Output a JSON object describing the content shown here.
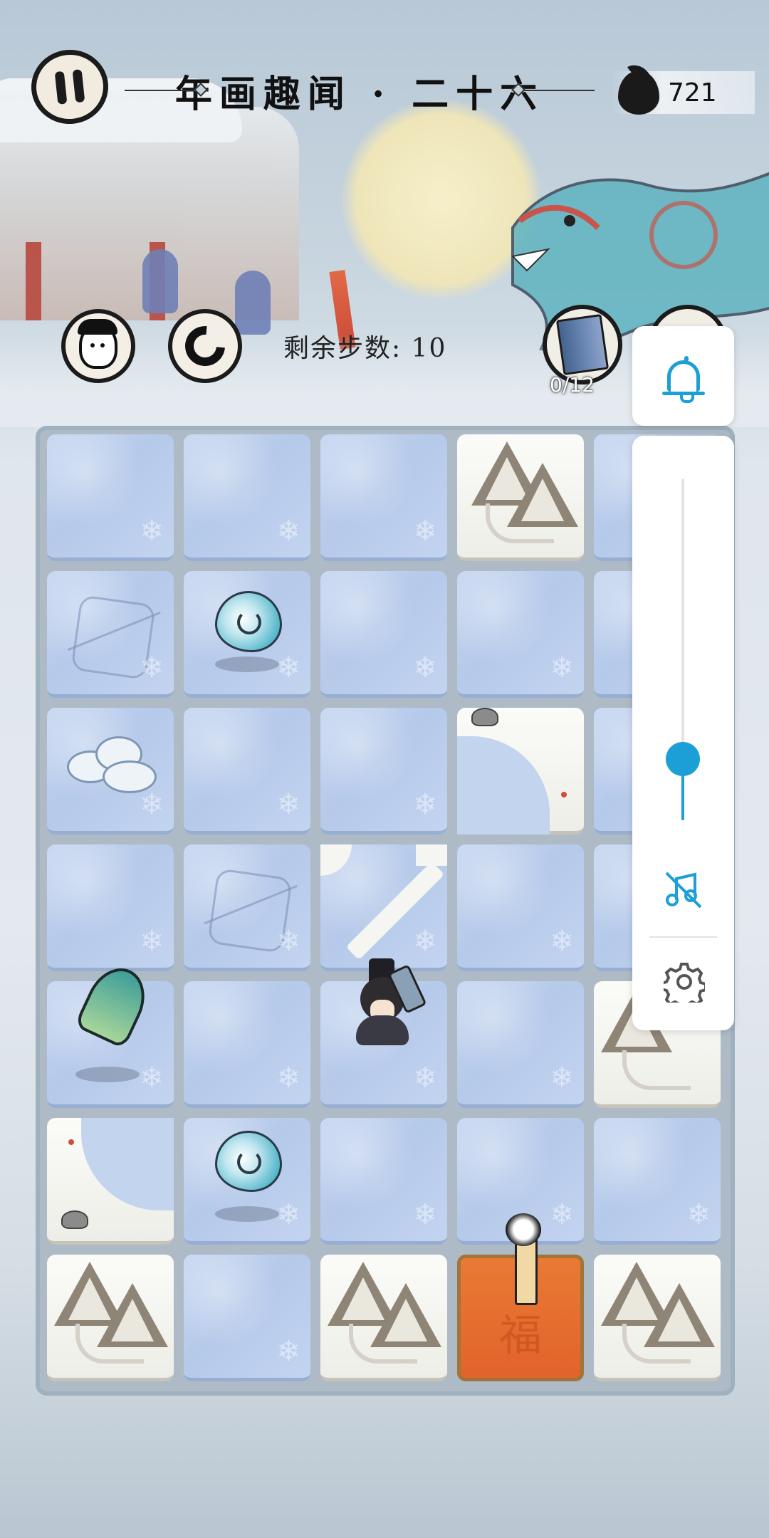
{
  "header": {
    "title": "年画趣闻 · 二十六",
    "ink_count": "721"
  },
  "toolbar": {
    "steps_label": "剩余步数: 10",
    "collection_count": "0/12"
  },
  "board_tile": {
    "goal_char": "福"
  },
  "side_panel": {
    "volume_level": 0.18,
    "accent_color": "#1b9fd6",
    "icons": [
      "bell-icon",
      "music-muted-icon",
      "gear-icon"
    ]
  },
  "colors": {
    "ice_tile": "#b5c9ea",
    "goal_tile": "#e2632b",
    "board_frame": "#aebbc6"
  }
}
